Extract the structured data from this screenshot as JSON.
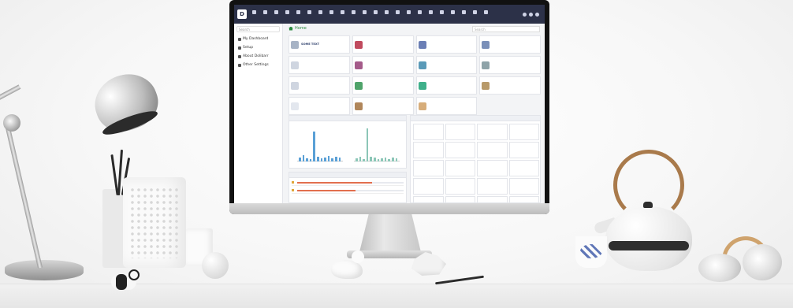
{
  "app": {
    "logo": "D",
    "nav": [
      "",
      "",
      "",
      "",
      "",
      "",
      "",
      "",
      "",
      "",
      "",
      "",
      "",
      "",
      "",
      "",
      "",
      "",
      "",
      "",
      "",
      ""
    ],
    "user": "",
    "sidebar": {
      "search_placeholder": "Search",
      "items": [
        {
          "label": "My Dashboard",
          "icon": "dashboard-icon"
        },
        {
          "label": "Setup",
          "icon": "wrench-icon"
        },
        {
          "label": "About Dolibarr",
          "icon": "info-icon"
        },
        {
          "label": "Other Settings",
          "icon": "gear-icon"
        }
      ]
    },
    "breadcrumb": "Home",
    "search_placeholder": "Search",
    "boxes": [
      {
        "title": "Some text",
        "line": "",
        "badge": "",
        "color": "#a7b3c5"
      },
      {
        "title": "",
        "line": "",
        "badge": "",
        "color": "#c04a5e"
      },
      {
        "title": "",
        "line": "",
        "badge": "",
        "color": "#6b7fb5"
      },
      {
        "title": "",
        "line": "",
        "badge": "",
        "color": "#7a8fb8"
      },
      {
        "title": "",
        "line": "",
        "badge": "",
        "color": "#cfd5e0"
      },
      {
        "title": "",
        "line": "",
        "badge": "",
        "color": "#a45b8a"
      },
      {
        "title": "",
        "line": "",
        "badge": "",
        "color": "#5a9ab8"
      },
      {
        "title": "",
        "line": "",
        "badge": "",
        "color": "#8ea3a8"
      },
      {
        "title": "",
        "line": "",
        "badge": "",
        "color": "#cfd5e0"
      },
      {
        "title": "",
        "line": "",
        "badge": "",
        "color": "#4fa36a"
      },
      {
        "title": "",
        "line": "",
        "badge": "",
        "color": "#3fb08a"
      },
      {
        "title": "",
        "line": "",
        "badge": "",
        "color": "#b89a6a"
      },
      {
        "title": "",
        "line": "",
        "badge": "",
        "color": "#e3e7ee"
      },
      {
        "title": "",
        "line": "",
        "badge": "",
        "color": "#b0865a"
      },
      {
        "title": "",
        "line": "",
        "badge": "",
        "color": "#d7ad7a"
      }
    ],
    "chart_panel": {
      "title": "",
      "sub1": "",
      "sub2": ""
    },
    "chart_bars": [
      5,
      8,
      4,
      3,
      36,
      6,
      4,
      5,
      7,
      4,
      6,
      5
    ],
    "chart_bars2": [
      4,
      6,
      3,
      40,
      6,
      5,
      3,
      4,
      5,
      3,
      5,
      4
    ],
    "stats_panel": {
      "title": ""
    },
    "stats": [
      {
        "label": "",
        "value": ""
      },
      {
        "label": "",
        "value": ""
      },
      {
        "label": "",
        "value": ""
      },
      {
        "label": "",
        "value": ""
      },
      {
        "label": "",
        "value": ""
      },
      {
        "label": "",
        "value": ""
      },
      {
        "label": "",
        "value": ""
      },
      {
        "label": "",
        "value": ""
      },
      {
        "label": "",
        "value": ""
      },
      {
        "label": "",
        "value": ""
      },
      {
        "label": "",
        "value": ""
      },
      {
        "label": "",
        "value": ""
      },
      {
        "label": "",
        "value": ""
      },
      {
        "label": "",
        "value": ""
      },
      {
        "label": "",
        "value": ""
      },
      {
        "label": "",
        "value": ""
      },
      {
        "label": "",
        "value": ""
      },
      {
        "label": "",
        "value": ""
      },
      {
        "label": "",
        "value": ""
      },
      {
        "label": "",
        "value": ""
      }
    ],
    "list_panel": {
      "title": ""
    },
    "list_rows": [
      {
        "label": "",
        "progress": 0.7
      },
      {
        "label": "",
        "progress": 0.55
      }
    ]
  },
  "colors": {
    "topbar": "#2c3148",
    "accent_green": "#2a8a3e",
    "badge": "#f0b429"
  }
}
